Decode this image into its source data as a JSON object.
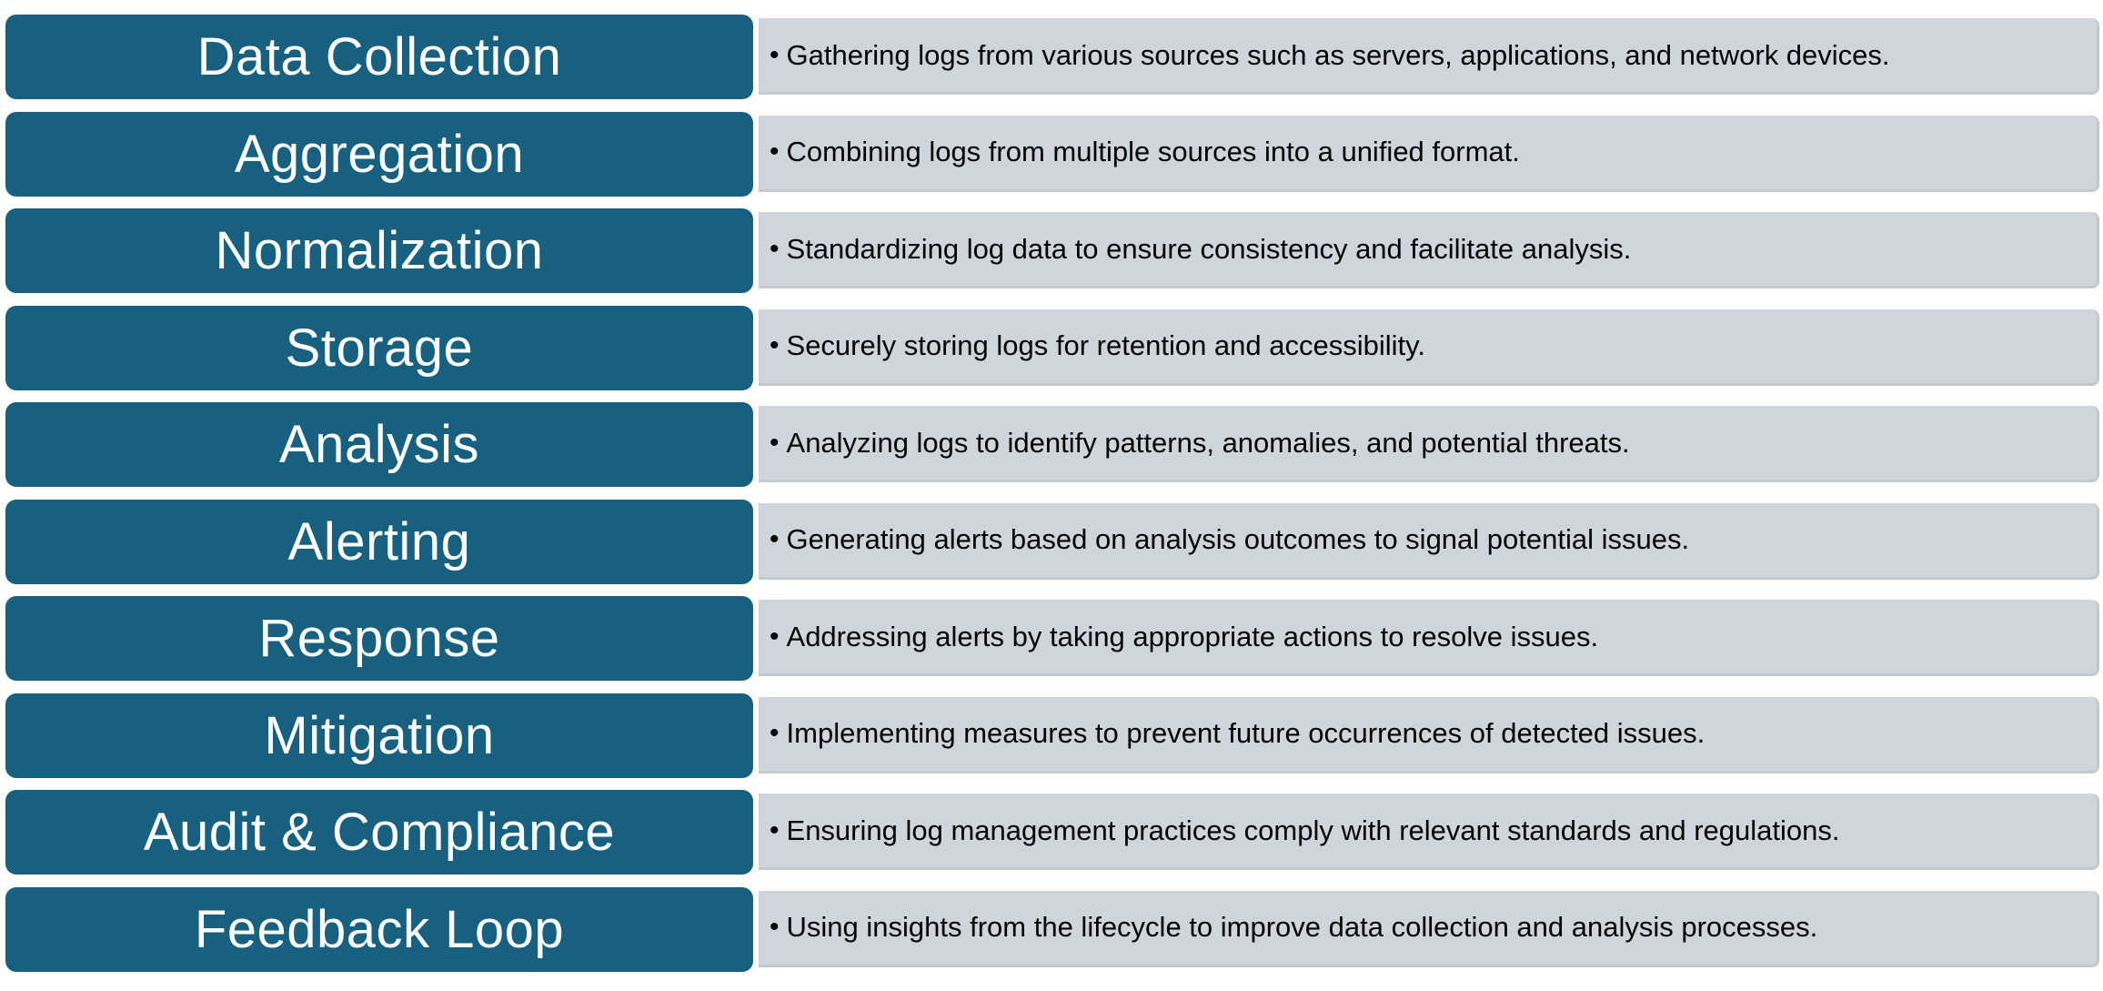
{
  "colors": {
    "label_bg": "#17607f",
    "panel_bg": "#d0d5dc"
  },
  "rows": [
    {
      "title": "Data Collection",
      "description": "Gathering logs from various sources such as servers, applications, and network devices."
    },
    {
      "title": "Aggregation",
      "description": "Combining logs from multiple sources into a unified format."
    },
    {
      "title": "Normalization",
      "description": "Standardizing log data to ensure consistency and facilitate analysis."
    },
    {
      "title": "Storage",
      "description": "Securely storing logs for retention and accessibility."
    },
    {
      "title": "Analysis",
      "description": "Analyzing logs to identify patterns, anomalies, and potential threats."
    },
    {
      "title": "Alerting",
      "description": "Generating alerts based on analysis outcomes to signal potential issues."
    },
    {
      "title": "Response",
      "description": "Addressing alerts by taking appropriate actions to resolve issues."
    },
    {
      "title": "Mitigation",
      "description": "Implementing measures to prevent future occurrences of detected issues."
    },
    {
      "title": "Audit & Compliance",
      "description": "Ensuring log management practices comply with relevant standards and regulations."
    },
    {
      "title": "Feedback Loop",
      "description": "Using insights from the lifecycle to improve data collection and analysis processes."
    }
  ],
  "bullet": "•"
}
